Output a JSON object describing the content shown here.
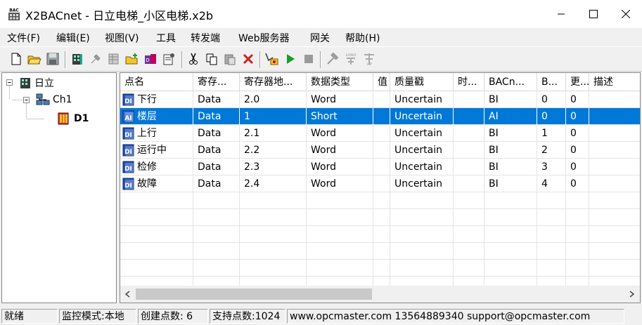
{
  "window": {
    "title": "X2BACnet - 日立电梯_小区电梯.x2b",
    "icon_text": "BAC"
  },
  "menu": [
    "文件(F)",
    "编辑(E)",
    "视图(V)",
    "工具",
    "转发端",
    "Web服务器",
    "网关",
    "帮助(H)"
  ],
  "toolbar": {
    "load_label": "LOAD",
    "up_label": "UP"
  },
  "tree": {
    "root": "日立",
    "channel": "Ch1",
    "device": "D1"
  },
  "columns": [
    "点名",
    "寄存...",
    "寄存器地...",
    "数据类型",
    "值",
    "质量戳",
    "时...",
    "BACn...",
    "B...",
    "更...",
    "描述"
  ],
  "rows": [
    {
      "name": "下行",
      "reg": "Data",
      "addr": "2.0",
      "type": "Word",
      "value": "",
      "quality": "Uncertain",
      "time": "",
      "bac": "BI",
      "b": "0",
      "upd": "0",
      "desc": "",
      "icon": "DI"
    },
    {
      "name": "楼层",
      "reg": "Data",
      "addr": "1",
      "type": "Short",
      "value": "",
      "quality": "Uncertain",
      "time": "",
      "bac": "AI",
      "b": "0",
      "upd": "0",
      "desc": "",
      "icon": "AI"
    },
    {
      "name": "上行",
      "reg": "Data",
      "addr": "2.1",
      "type": "Word",
      "value": "",
      "quality": "Uncertain",
      "time": "",
      "bac": "BI",
      "b": "1",
      "upd": "0",
      "desc": "",
      "icon": "DI"
    },
    {
      "name": "运行中",
      "reg": "Data",
      "addr": "2.2",
      "type": "Word",
      "value": "",
      "quality": "Uncertain",
      "time": "",
      "bac": "BI",
      "b": "2",
      "upd": "0",
      "desc": "",
      "icon": "DI"
    },
    {
      "name": "检修",
      "reg": "Data",
      "addr": "2.3",
      "type": "Word",
      "value": "",
      "quality": "Uncertain",
      "time": "",
      "bac": "BI",
      "b": "3",
      "upd": "0",
      "desc": "",
      "icon": "DI"
    },
    {
      "name": "故障",
      "reg": "Data",
      "addr": "2.4",
      "type": "Word",
      "value": "",
      "quality": "Uncertain",
      "time": "",
      "bac": "BI",
      "b": "4",
      "upd": "0",
      "desc": "",
      "icon": "DI"
    }
  ],
  "selected_row": 1,
  "status": {
    "ready": "就绪",
    "mode": "监控模式:本地",
    "created": "创建点数: 6",
    "supported": "支持点数:1024",
    "contact": "www.opcmaster.com 13564889340 support@opcmaster.com"
  },
  "colors": {
    "selection": "#0078d7",
    "play": "#1a9e2a",
    "delete": "#d02020"
  }
}
